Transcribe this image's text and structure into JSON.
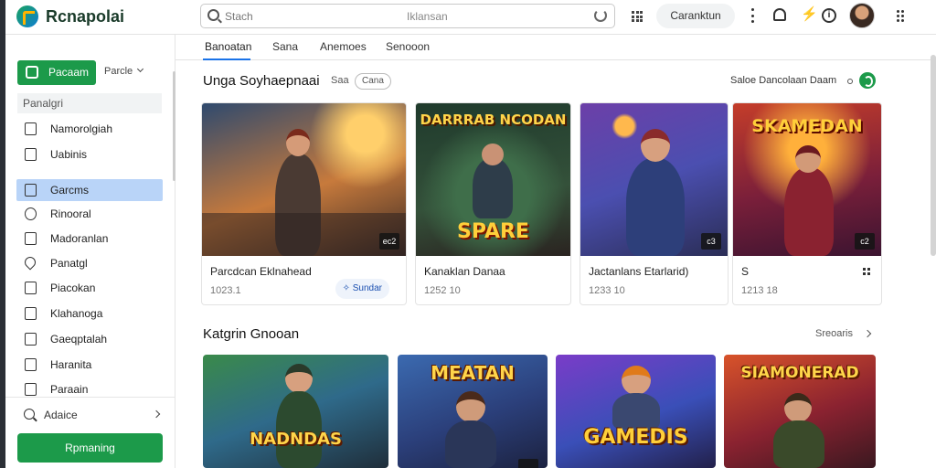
{
  "app": {
    "title": "Rcnapolai"
  },
  "search": {
    "placeholder": "Stach",
    "hint": "Iklansan"
  },
  "topbar": {
    "button_label": "Caranktun"
  },
  "sidebar": {
    "primary_button": "Pacaam",
    "select_label": "Parcle",
    "section_label": "Panalgri",
    "items": [
      {
        "label": "Namorolgiah",
        "icon": "document-icon"
      },
      {
        "label": "Uabinis",
        "icon": "file-icon"
      },
      {
        "label": "Garcms",
        "icon": "games-icon",
        "active": true
      },
      {
        "label": "Rinooral",
        "icon": "circle-icon"
      },
      {
        "label": "Madoranlan",
        "icon": "media-icon"
      },
      {
        "label": "Panatgl",
        "icon": "location-icon"
      },
      {
        "label": "Piacokan",
        "icon": "file-icon"
      },
      {
        "label": "Klahanoga",
        "icon": "box-icon"
      },
      {
        "label": "Gaeqptalah",
        "icon": "tag-icon"
      },
      {
        "label": "Haranita",
        "icon": "folder-icon"
      },
      {
        "label": "Paraain",
        "icon": "file-icon"
      }
    ],
    "search_label": "Adaice",
    "cta_label": "Rpmaning"
  },
  "tabs": [
    {
      "label": "Banoatan",
      "active": true
    },
    {
      "label": "Sana"
    },
    {
      "label": "Anemoes"
    },
    {
      "label": "Senooon"
    }
  ],
  "section1": {
    "title": "Unga Soyhaepnaai",
    "subtitle": "Saa",
    "chip": "Cana",
    "right_label": "Saloe Dancolaan Daam"
  },
  "cards": [
    {
      "title": "Parcdcan Eklnahead",
      "meta": "1023.1",
      "badge": "ec2",
      "action": "Sundar"
    },
    {
      "title": "Kanaklan Danaa",
      "meta": "1252 10",
      "badge": "",
      "thumb_text_top": "DARRRAB NCODAN",
      "thumb_text_bottom": "SPARE"
    },
    {
      "title": "Jactanlans Etarlarid)",
      "meta": "1233 10",
      "badge": "c3"
    },
    {
      "title": "S",
      "meta": "1213 18",
      "badge": "c2",
      "thumb_text_top": "SKAMEDAN"
    }
  ],
  "section2": {
    "title": "Katgrin Gnooan",
    "link": "Sreoaris"
  },
  "tiles": [
    {
      "text": "NADNDAS"
    },
    {
      "text": "MEATAN"
    },
    {
      "text": "GAMEDIS"
    },
    {
      "text": "SIAMONERAD"
    }
  ],
  "colors": {
    "accent_green": "#1c9a4a",
    "active_blue": "#b9d4f8",
    "tab_blue": "#1a73e8"
  }
}
